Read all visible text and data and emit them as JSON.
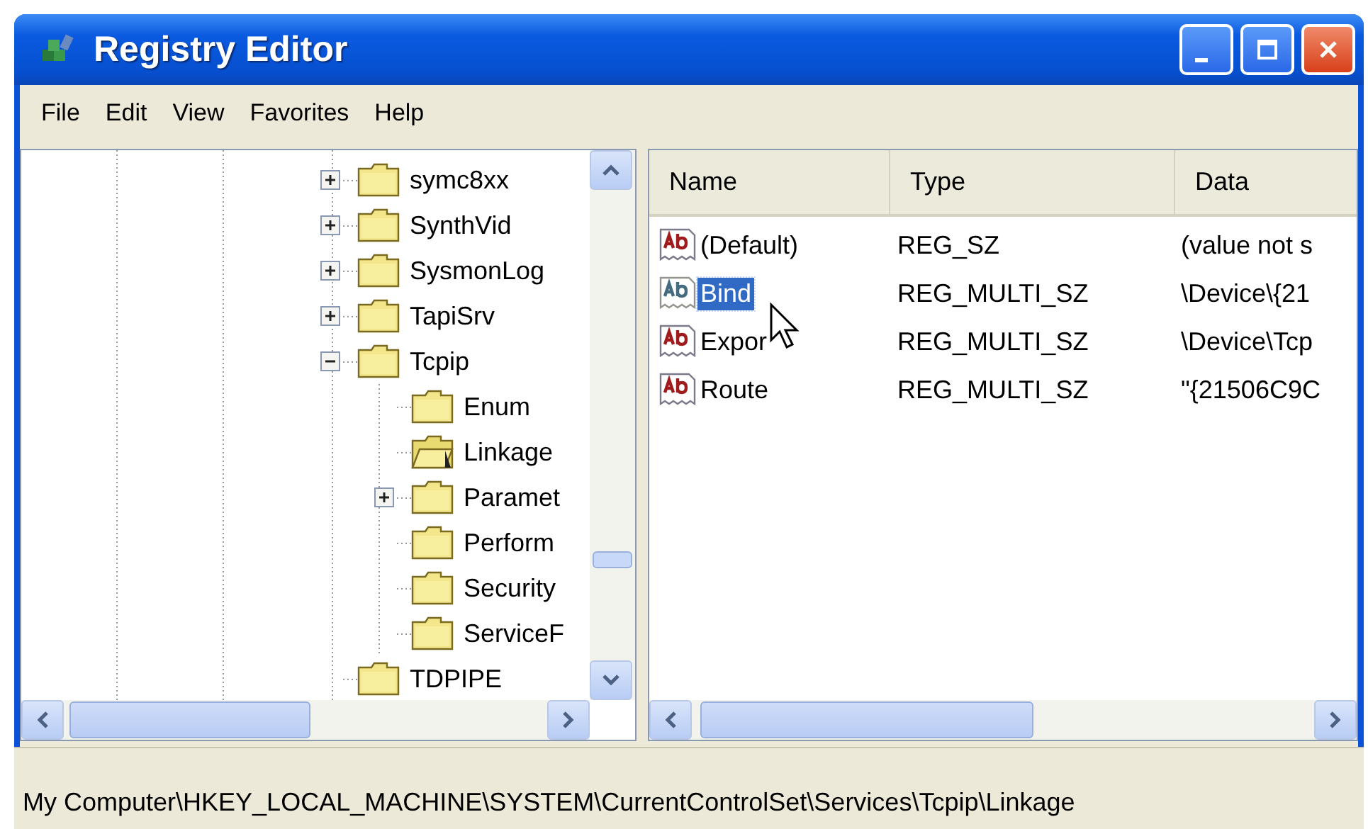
{
  "window": {
    "title": "Registry Editor"
  },
  "menu": [
    "File",
    "Edit",
    "View",
    "Favorites",
    "Help"
  ],
  "tree": {
    "nodes": [
      {
        "label": "symc8xx",
        "expandable": true,
        "expanded": false,
        "selected": false
      },
      {
        "label": "SynthVid",
        "expandable": true,
        "expanded": false,
        "selected": false
      },
      {
        "label": "SysmonLog",
        "expandable": true,
        "expanded": false,
        "selected": false
      },
      {
        "label": "TapiSrv",
        "expandable": true,
        "expanded": false,
        "selected": false
      },
      {
        "label": "Tcpip",
        "expandable": true,
        "expanded": true,
        "selected": false,
        "children": [
          {
            "label": "Enum",
            "expandable": false,
            "expanded": false,
            "selected": false
          },
          {
            "label": "Linkage",
            "expandable": false,
            "expanded": false,
            "selected": true
          },
          {
            "label": "Paramet",
            "expandable": true,
            "expanded": false,
            "selected": false
          },
          {
            "label": "Perform",
            "expandable": false,
            "expanded": false,
            "selected": false
          },
          {
            "label": "Security",
            "expandable": false,
            "expanded": false,
            "selected": false
          },
          {
            "label": "ServiceF",
            "expandable": false,
            "expanded": false,
            "selected": false
          }
        ]
      },
      {
        "label": "TDPIPE",
        "expandable": false,
        "expanded": false,
        "selected": false
      }
    ]
  },
  "values": {
    "columns": [
      "Name",
      "Type",
      "Data"
    ],
    "rows": [
      {
        "name": "(Default)",
        "type": "REG_SZ",
        "data": "(value not s",
        "selected": false
      },
      {
        "name": "Bind",
        "type": "REG_MULTI_SZ",
        "data": "\\Device\\{21",
        "selected": true
      },
      {
        "name": "Expor",
        "type": "REG_MULTI_SZ",
        "data": "\\Device\\Tcp",
        "selected": false
      },
      {
        "name": "Route",
        "type": "REG_MULTI_SZ",
        "data": "\"{21506C9C",
        "selected": false
      }
    ]
  },
  "status_bar": "My Computer\\HKEY_LOCAL_MACHINE\\SYSTEM\\CurrentControlSet\\Services\\Tcpip\\Linkage"
}
